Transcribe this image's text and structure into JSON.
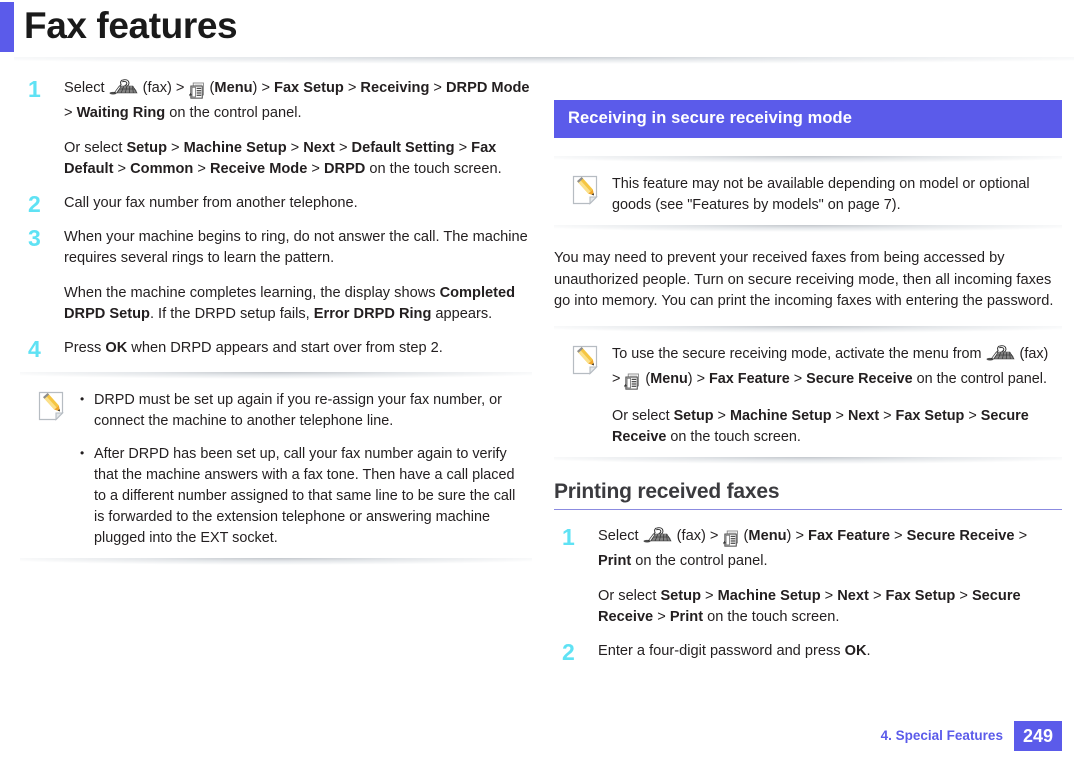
{
  "header": {
    "title": "Fax features",
    "accent_color": "#5b5bea"
  },
  "colors": {
    "accent": "#5b5bea",
    "step_number": "#5fe2f4",
    "subhead_rule": "#8b8be0"
  },
  "left_column": {
    "steps": [
      {
        "number": "1",
        "paragraphs": [
          {
            "runs": [
              {
                "t": "Select ",
                "b": false
              },
              {
                "icon": "fax-icon"
              },
              {
                "t": " (fax) > ",
                "b": false
              },
              {
                "icon": "menu-icon"
              },
              {
                "t": " (",
                "b": false
              },
              {
                "t": "Menu",
                "b": true
              },
              {
                "t": ") > ",
                "b": false
              },
              {
                "t": "Fax Setup",
                "b": true
              },
              {
                "t": " > ",
                "b": false
              },
              {
                "t": "Receiving",
                "b": true
              },
              {
                "t": " > ",
                "b": false
              },
              {
                "t": "DRPD Mode",
                "b": true
              },
              {
                "t": " > ",
                "b": false
              },
              {
                "t": "Waiting Ring",
                "b": true
              },
              {
                "t": " on the control panel.",
                "b": false
              }
            ]
          },
          {
            "runs": [
              {
                "t": "Or select ",
                "b": false
              },
              {
                "t": "Setup",
                "b": true
              },
              {
                "t": " > ",
                "b": false
              },
              {
                "t": "Machine Setup",
                "b": true
              },
              {
                "t": " > ",
                "b": false
              },
              {
                "t": "Next",
                "b": true
              },
              {
                "t": " > ",
                "b": false
              },
              {
                "t": "Default Setting",
                "b": true
              },
              {
                "t": " > ",
                "b": false
              },
              {
                "t": "Fax Default",
                "b": true
              },
              {
                "t": " > ",
                "b": false
              },
              {
                "t": "Common",
                "b": true
              },
              {
                "t": " > ",
                "b": false
              },
              {
                "t": "Receive Mode",
                "b": true
              },
              {
                "t": " > ",
                "b": false
              },
              {
                "t": "DRPD",
                "b": true
              },
              {
                "t": " on the touch screen.",
                "b": false
              }
            ]
          }
        ]
      },
      {
        "number": "2",
        "paragraphs": [
          {
            "runs": [
              {
                "t": "Call your fax number from another telephone.",
                "b": false
              }
            ]
          }
        ]
      },
      {
        "number": "3",
        "paragraphs": [
          {
            "runs": [
              {
                "t": "When your machine begins to ring, do not answer the call. The machine requires several rings to learn the pattern.",
                "b": false
              }
            ]
          },
          {
            "runs": [
              {
                "t": "When the machine completes learning, the display shows ",
                "b": false
              },
              {
                "t": "Completed DRPD Setup",
                "b": true
              },
              {
                "t": ". If the DRPD setup fails, ",
                "b": false
              },
              {
                "t": "Error DRPD Ring",
                "b": true
              },
              {
                "t": " appears.",
                "b": false
              }
            ]
          }
        ]
      },
      {
        "number": "4",
        "paragraphs": [
          {
            "runs": [
              {
                "t": "Press ",
                "b": false
              },
              {
                "t": "OK",
                "b": true
              },
              {
                "t": " when DRPD appears and start over from step 2.",
                "b": false
              }
            ]
          }
        ]
      }
    ],
    "note": {
      "icon": "note-pencil-icon",
      "bullets": [
        "DRPD must be set up again if you re-assign your fax number, or connect the machine to another telephone line.",
        "After DRPD has been set up, call your fax number again to verify that the machine answers with a fax tone. Then have a call placed to a different number assigned to that same line to be sure the call is forwarded to the extension telephone or answering machine plugged into the EXT socket."
      ]
    }
  },
  "right_column": {
    "section_bar": "Receiving in secure receiving mode",
    "note_top": {
      "icon": "note-pencil-icon",
      "text": "This feature may not be available depending on model or optional goods (see \"Features by models\" on page 7)."
    },
    "body_paragraph": "You may need to prevent your received faxes from being accessed by unauthorized people. Turn on secure receiving mode, then all incoming faxes go into memory. You can print the incoming faxes with entering the password.",
    "note_bottom": {
      "icon": "note-pencil-icon",
      "paragraphs": [
        {
          "runs": [
            {
              "t": "To use the secure receiving mode, activate the menu from ",
              "b": false
            },
            {
              "icon": "fax-icon"
            },
            {
              "t": " (fax) > ",
              "b": false
            },
            {
              "icon": "menu-icon"
            },
            {
              "t": " (",
              "b": false
            },
            {
              "t": "Menu",
              "b": true
            },
            {
              "t": ") > ",
              "b": false
            },
            {
              "t": "Fax Feature",
              "b": true
            },
            {
              "t": " > ",
              "b": false
            },
            {
              "t": "Secure Receive",
              "b": true
            },
            {
              "t": " on the control panel.",
              "b": false
            }
          ]
        },
        {
          "runs": [
            {
              "t": "Or select ",
              "b": false
            },
            {
              "t": "Setup",
              "b": true
            },
            {
              "t": " > ",
              "b": false
            },
            {
              "t": "Machine Setup",
              "b": true
            },
            {
              "t": " > ",
              "b": false
            },
            {
              "t": "Next",
              "b": true
            },
            {
              "t": " > ",
              "b": false
            },
            {
              "t": "Fax Setup",
              "b": true
            },
            {
              "t": " > ",
              "b": false
            },
            {
              "t": "Secure Receive",
              "b": true
            },
            {
              "t": " on the touch screen.",
              "b": false
            }
          ]
        }
      ]
    },
    "subheading": "Printing received faxes",
    "steps": [
      {
        "number": "1",
        "paragraphs": [
          {
            "runs": [
              {
                "t": "Select ",
                "b": false
              },
              {
                "icon": "fax-icon"
              },
              {
                "t": " (fax) > ",
                "b": false
              },
              {
                "icon": "menu-icon"
              },
              {
                "t": " (",
                "b": false
              },
              {
                "t": "Menu",
                "b": true
              },
              {
                "t": ") > ",
                "b": false
              },
              {
                "t": "Fax Feature",
                "b": true
              },
              {
                "t": " > ",
                "b": false
              },
              {
                "t": "Secure Receive",
                "b": true
              },
              {
                "t": " > ",
                "b": false
              },
              {
                "t": "Print",
                "b": true
              },
              {
                "t": " on the control panel.",
                "b": false
              }
            ]
          },
          {
            "runs": [
              {
                "t": "Or select ",
                "b": false
              },
              {
                "t": "Setup",
                "b": true
              },
              {
                "t": " > ",
                "b": false
              },
              {
                "t": "Machine Setup",
                "b": true
              },
              {
                "t": " > ",
                "b": false
              },
              {
                "t": "Next",
                "b": true
              },
              {
                "t": " > ",
                "b": false
              },
              {
                "t": "Fax Setup",
                "b": true
              },
              {
                "t": " > ",
                "b": false
              },
              {
                "t": "Secure Receive",
                "b": true
              },
              {
                "t": " > ",
                "b": false
              },
              {
                "t": "Print",
                "b": true
              },
              {
                "t": " on the touch screen.",
                "b": false
              }
            ]
          }
        ]
      },
      {
        "number": "2",
        "paragraphs": [
          {
            "runs": [
              {
                "t": "Enter a four-digit password and press ",
                "b": false
              },
              {
                "t": "OK",
                "b": true
              },
              {
                "t": ".",
                "b": false
              }
            ]
          }
        ]
      }
    ]
  },
  "footer": {
    "chapter_label": "4.  Special Features",
    "page_number": "249"
  }
}
